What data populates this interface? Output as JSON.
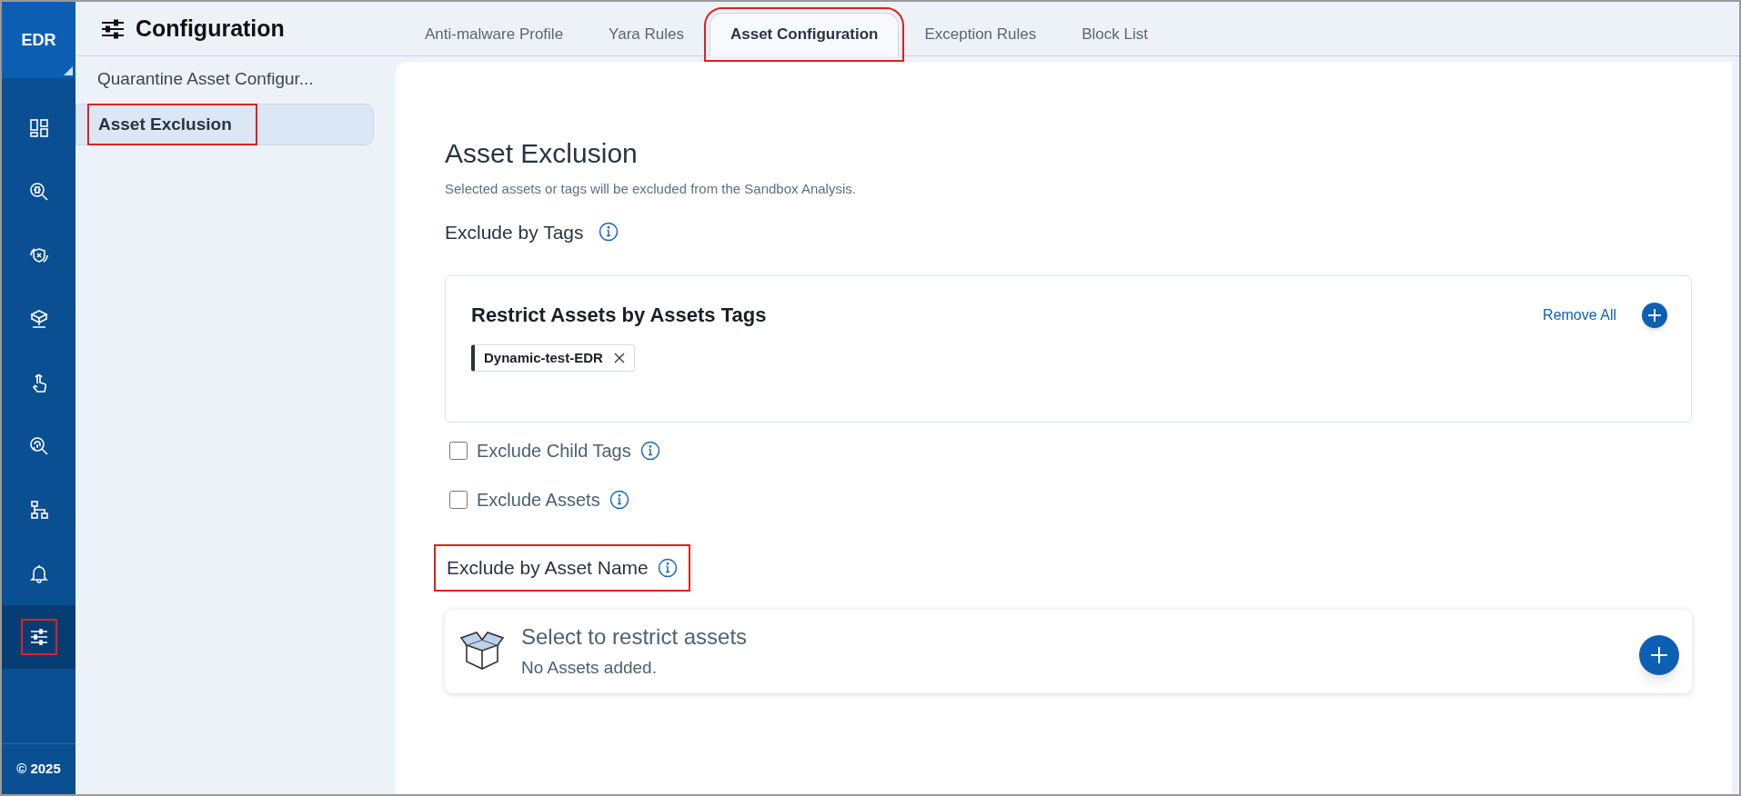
{
  "rail": {
    "logo": "EDR",
    "footer": "© 2025",
    "items": [
      {
        "kind": "dashboard",
        "selected": false,
        "annotated": false
      },
      {
        "kind": "bug-search",
        "selected": false,
        "annotated": false
      },
      {
        "kind": "shield-sync",
        "selected": false,
        "annotated": false
      },
      {
        "kind": "network",
        "selected": false,
        "annotated": false
      },
      {
        "kind": "hand",
        "selected": false,
        "annotated": false
      },
      {
        "kind": "fingerprint",
        "selected": false,
        "annotated": false
      },
      {
        "kind": "hierarchy",
        "selected": false,
        "annotated": false
      },
      {
        "kind": "bell",
        "selected": false,
        "annotated": false
      },
      {
        "kind": "sliders",
        "selected": true,
        "annotated": true
      }
    ]
  },
  "page_title": "Configuration",
  "tabs": [
    {
      "label": "Anti-malware Profile",
      "selected": false,
      "annotated": false
    },
    {
      "label": "Yara Rules",
      "selected": false,
      "annotated": false
    },
    {
      "label": "Asset Configuration",
      "selected": true,
      "annotated": true
    },
    {
      "label": "Exception Rules",
      "selected": false,
      "annotated": false
    },
    {
      "label": "Block List",
      "selected": false,
      "annotated": false
    }
  ],
  "sidebar": {
    "items": [
      {
        "label": "Quarantine Asset Configur...",
        "selected": false,
        "annotated": false
      },
      {
        "label": "Asset Exclusion",
        "selected": true,
        "annotated": true
      }
    ]
  },
  "content": {
    "title": "Asset Exclusion",
    "subtitle": "Selected assets or tags will be excluded from the Sandbox Analysis.",
    "tags_section": {
      "heading": "Exclude by Tags",
      "annotated": false,
      "card": {
        "title": "Restrict Assets by Assets Tags",
        "remove_all": "Remove All",
        "tags": [
          {
            "label": "Dynamic-test-EDR"
          }
        ]
      },
      "options": [
        {
          "label": "Exclude Child Tags",
          "checked": false
        },
        {
          "label": "Exclude Assets",
          "checked": false
        }
      ]
    },
    "name_section": {
      "heading": "Exclude by Asset Name",
      "annotated": true,
      "card": {
        "title": "Select to restrict assets",
        "message": "No Assets added."
      }
    }
  }
}
